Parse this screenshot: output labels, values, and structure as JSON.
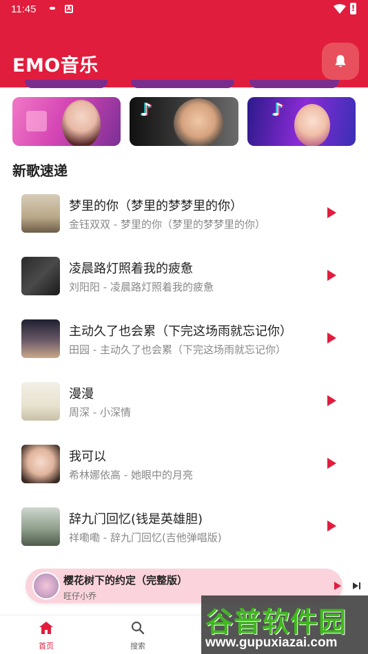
{
  "status_bar": {
    "time": "11:45",
    "notif_icon": "A"
  },
  "app": {
    "title": "EMO音乐"
  },
  "section": {
    "new_songs_title": "新歌速递"
  },
  "songs": [
    {
      "title": "梦里的你（梦里的梦梦里的你）",
      "subtitle": "金钰双双 - 梦里的你（梦里的梦梦里的你）"
    },
    {
      "title": "凌晨路灯照着我的疲惫",
      "subtitle": "刘阳阳 - 凌晨路灯照着我的疲惫"
    },
    {
      "title": "主动久了也会累（下完这场雨就忘记你）",
      "subtitle": "田园 - 主动久了也会累（下完这场雨就忘记你）"
    },
    {
      "title": "漫漫",
      "subtitle": "周深 - 小深情"
    },
    {
      "title": "我可以",
      "subtitle": "希林娜依高 - 她眼中的月亮"
    },
    {
      "title": "辞九门回忆(钱是英雄胆)",
      "subtitle": "祥嘞嘞 - 辞九门回忆(吉他弹唱版)"
    }
  ],
  "mini_player": {
    "title": "樱花树下的约定（完整版）",
    "artist": "旺仔小乔"
  },
  "bottom_nav": {
    "home_label": "首页",
    "search_label": "搜索"
  },
  "watermark": {
    "text": "谷普软件园",
    "url": "www.gupuxiazai.com"
  },
  "colors": {
    "accent": "#e11d3d",
    "mini_player_bg": "#fbd3dc"
  }
}
